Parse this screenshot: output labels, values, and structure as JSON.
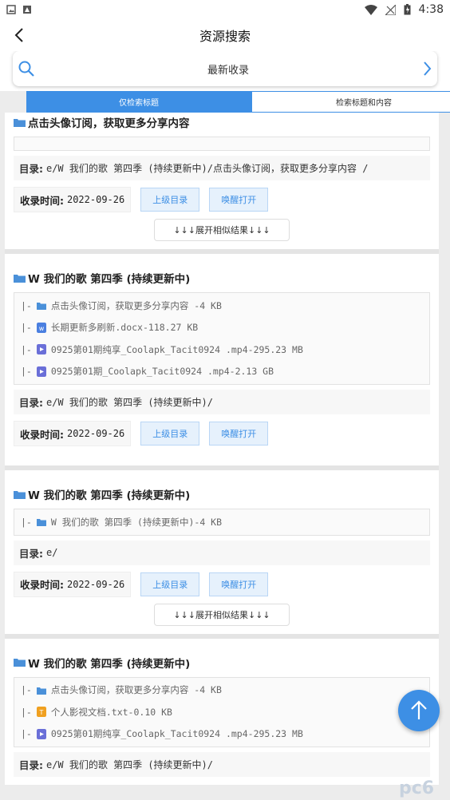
{
  "statusbar": {
    "time": "4:38"
  },
  "header": {
    "title": "资源搜索"
  },
  "search": {
    "query": "最新收录"
  },
  "tabs": [
    {
      "label": "仅检索标题",
      "active": true
    },
    {
      "label": "检索标题和内容",
      "active": false
    }
  ],
  "labels": {
    "dir": "目录:",
    "time": "收录时间:",
    "parent_btn": "上级目录",
    "open_btn": "唤醒打开",
    "expand": "↓↓↓展开相似结果↓↓↓"
  },
  "results": [
    {
      "title": "点击头像订阅，获取更多分享内容",
      "files": [],
      "dir": "e/W 我们的歌 第四季 (持续更新中)/点击头像订阅，获取更多分享内容 /",
      "time": "2022-09-26",
      "expand": true
    },
    {
      "title": "W 我们的歌 第四季 (持续更新中)",
      "files": [
        {
          "prefix": "|-",
          "icon": "folder-icon",
          "name": "点击头像订阅，获取更多分享内容 -4 KB"
        },
        {
          "prefix": "|-",
          "icon": "doc-file-icon",
          "name": "长期更新多刷新.docx-118.27 KB"
        },
        {
          "prefix": "|-",
          "icon": "video-file-icon",
          "name": "0925第01期纯享_Coolapk_Tacit0924 .mp4-295.23 MB"
        },
        {
          "prefix": "|-",
          "icon": "video-file-icon",
          "name": "0925第01期_Coolapk_Tacit0924 .mp4-2.13 GB"
        }
      ],
      "dir": "e/W 我们的歌 第四季 (持续更新中)/",
      "time": "2022-09-26",
      "expand": false
    },
    {
      "title": "W 我们的歌 第四季 (持续更新中)",
      "files": [
        {
          "prefix": "|-",
          "icon": "folder-icon",
          "name": "W 我们的歌 第四季 (持续更新中)-4 KB"
        }
      ],
      "dir": "e/",
      "time": "2022-09-26",
      "expand": true
    },
    {
      "title": "W 我们的歌 第四季 (持续更新中)",
      "files": [
        {
          "prefix": "|-",
          "icon": "folder-icon",
          "name": "点击头像订阅，获取更多分享内容 -4 KB"
        },
        {
          "prefix": "|-",
          "icon": "txt-file-icon",
          "name": "个人影视文档.txt-0.10 KB"
        },
        {
          "prefix": "|-",
          "icon": "video-file-icon",
          "name": "0925第01期纯享_Coolapk_Tacit0924 .mp4-295.23 MB"
        }
      ],
      "dir": "e/W 我们的歌 第四季 (持续更新中)/",
      "time": "",
      "expand": false
    }
  ],
  "watermark": "pc6",
  "colors": {
    "accent": "#3d8fe5",
    "doc": "#4a7fe0",
    "video": "#6a6fd8",
    "txt": "#f0a020",
    "folder": "#4a90d9"
  }
}
